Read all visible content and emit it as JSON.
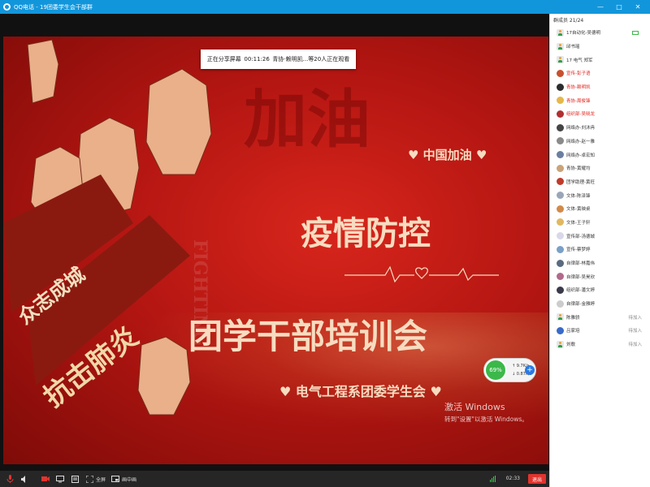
{
  "window": {
    "title": "QQ电话 - 19团委学生会干部群",
    "controls": [
      "—",
      "□",
      "✕"
    ]
  },
  "share": {
    "status_label": "正在分享屏幕",
    "elapsed": "00:11:26",
    "watchers": "青协·赖明凯...等20人正在观看"
  },
  "slide": {
    "bg_jiayou": "加油",
    "heart_top": "♥ 中国加油 ♥",
    "title1": "疫情防控",
    "title2": "团学干部培训会",
    "subtitle": "♥ 电气工程系团委学生会 ♥",
    "left_slogan1": "众志成城",
    "left_slogan2": "抗击肺炎",
    "fighting_text": "FIGHTING"
  },
  "speed_widget": {
    "percent": "69%",
    "up": "9.7K/s",
    "down": "0.87K/s",
    "plus": "+"
  },
  "activation": {
    "line1": "激活 Windows",
    "line2": "转到\"设置\"以激活 Windows。"
  },
  "toolbar": {
    "fullscreen": "全屏",
    "pip": "画中画",
    "time": "02:33",
    "exit": "退出"
  },
  "members": {
    "header": "群成员 21/24",
    "list": [
      {
        "name": "17自动化-吴德明",
        "color": "normal",
        "status": "",
        "cam": true,
        "avatar": "user"
      },
      {
        "name": "邱书瑶",
        "color": "normal",
        "status": "",
        "cam": false,
        "avatar": "user"
      },
      {
        "name": "17 电气  郑军",
        "color": "normal",
        "status": "",
        "cam": false,
        "avatar": "user"
      },
      {
        "name": "宣传-彭子语",
        "color": "red",
        "status": "",
        "cam": false,
        "avatar": "photo",
        "av_color": "#c8502e"
      },
      {
        "name": "青协-赖明凯",
        "color": "red",
        "status": "",
        "cam": false,
        "avatar": "photo",
        "av_color": "#2c2c2c"
      },
      {
        "name": "青协-周俊锋",
        "color": "red",
        "status": "",
        "cam": false,
        "avatar": "photo",
        "av_color": "#e5b84a"
      },
      {
        "name": "组织部-吴晓龙",
        "color": "red",
        "status": "",
        "cam": false,
        "avatar": "photo",
        "av_color": "#b03030"
      },
      {
        "name": "网络办-刘沐冉",
        "color": "normal",
        "status": "",
        "cam": false,
        "avatar": "photo",
        "av_color": "#444"
      },
      {
        "name": "网络办-赵一雅",
        "color": "normal",
        "status": "",
        "cam": false,
        "avatar": "photo",
        "av_color": "#8a8a8a"
      },
      {
        "name": "网络办-卓宏知",
        "color": "normal",
        "status": "",
        "cam": false,
        "avatar": "photo",
        "av_color": "#6a7fa0"
      },
      {
        "name": "青协-黄耀均",
        "color": "normal",
        "status": "",
        "cam": false,
        "avatar": "photo",
        "av_color": "#c9a37a"
      },
      {
        "name": "团学助理-黄旺",
        "color": "normal",
        "status": "",
        "cam": false,
        "avatar": "photo",
        "av_color": "#c03a2b"
      },
      {
        "name": "文体-陈泽锋",
        "color": "normal",
        "status": "",
        "cam": false,
        "avatar": "photo",
        "av_color": "#9aa6b8"
      },
      {
        "name": "文体-黄映桌",
        "color": "normal",
        "status": "",
        "cam": false,
        "avatar": "photo",
        "av_color": "#d28a4a"
      },
      {
        "name": "文体-王子轩",
        "color": "normal",
        "status": "",
        "cam": false,
        "avatar": "photo",
        "av_color": "#e0b860"
      },
      {
        "name": "宣传部-汤德城",
        "color": "normal",
        "status": "",
        "cam": false,
        "avatar": "photo",
        "av_color": "#d8d8e8"
      },
      {
        "name": "宣传-蔡梦婷",
        "color": "normal",
        "status": "",
        "cam": false,
        "avatar": "photo",
        "av_color": "#7aa0c8"
      },
      {
        "name": "自律部-林嘉伟",
        "color": "normal",
        "status": "",
        "cam": false,
        "avatar": "photo",
        "av_color": "#5a6a80"
      },
      {
        "name": "自律部-吴昊欣",
        "color": "normal",
        "status": "",
        "cam": false,
        "avatar": "photo",
        "av_color": "#b06a8a"
      },
      {
        "name": "组织部-潘文婷",
        "color": "normal",
        "status": "",
        "cam": false,
        "avatar": "photo",
        "av_color": "#3a3a4a"
      },
      {
        "name": "自律部-金雅婷",
        "color": "normal",
        "status": "",
        "cam": false,
        "avatar": "photo",
        "av_color": "#cccccc"
      },
      {
        "name": "陈雅骄",
        "color": "normal",
        "status": "待加入",
        "cam": false,
        "avatar": "user"
      },
      {
        "name": "吕家培",
        "color": "normal",
        "status": "待加入",
        "cam": false,
        "avatar": "photo",
        "av_color": "#3a6ac8"
      },
      {
        "name": "刘歌",
        "color": "normal",
        "status": "待加入",
        "cam": false,
        "avatar": "user"
      }
    ]
  }
}
